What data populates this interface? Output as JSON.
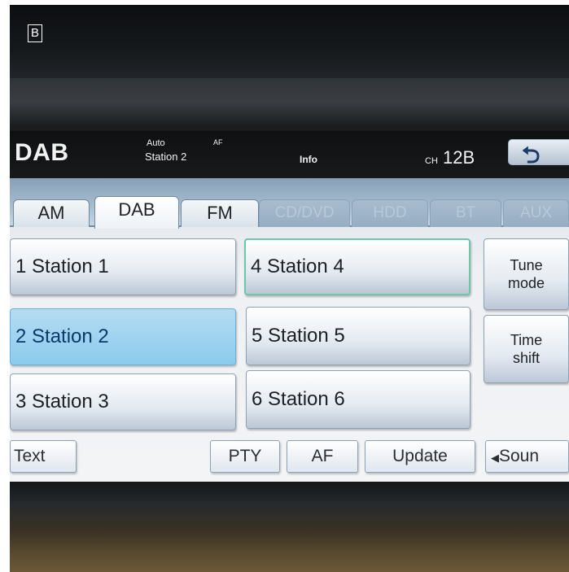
{
  "figure_label": "B",
  "header": {
    "source": "DAB",
    "mode": "Auto",
    "af_indicator": "AF",
    "station": "Station 2",
    "info": "Info",
    "channel_prefix": "CH",
    "channel": "12B",
    "back_icon": "return-arrow-icon"
  },
  "tabs": [
    {
      "label": "AM",
      "state": "normal"
    },
    {
      "label": "DAB",
      "state": "active"
    },
    {
      "label": "FM",
      "state": "normal"
    },
    {
      "label": "CD/DVD",
      "state": "disabled"
    },
    {
      "label": "HDD",
      "state": "disabled"
    },
    {
      "label": "BT",
      "state": "disabled"
    },
    {
      "label": "AUX",
      "state": "disabled"
    }
  ],
  "presets": [
    {
      "label": "1  Station 1",
      "state": "normal"
    },
    {
      "label": "2  Station 2",
      "state": "selected"
    },
    {
      "label": "3  Station 3",
      "state": "normal"
    },
    {
      "label": "4  Station 4",
      "state": "focused"
    },
    {
      "label": "5  Station 5",
      "state": "normal"
    },
    {
      "label": "6  Station 6",
      "state": "normal"
    }
  ],
  "side_buttons": {
    "tune_mode": [
      "Tune",
      "mode"
    ],
    "time_shift": [
      "Time",
      "shift"
    ]
  },
  "bottom_bar": {
    "text": "Text",
    "pty": "PTY",
    "af": "AF",
    "update": "Update",
    "sound": "Soun",
    "sound_icon": "speaker-icon"
  },
  "colors": {
    "selected_preset": "#8ccbee",
    "focus_outline": "#6cc7a9",
    "tab_strip": "#a7bdd0"
  }
}
